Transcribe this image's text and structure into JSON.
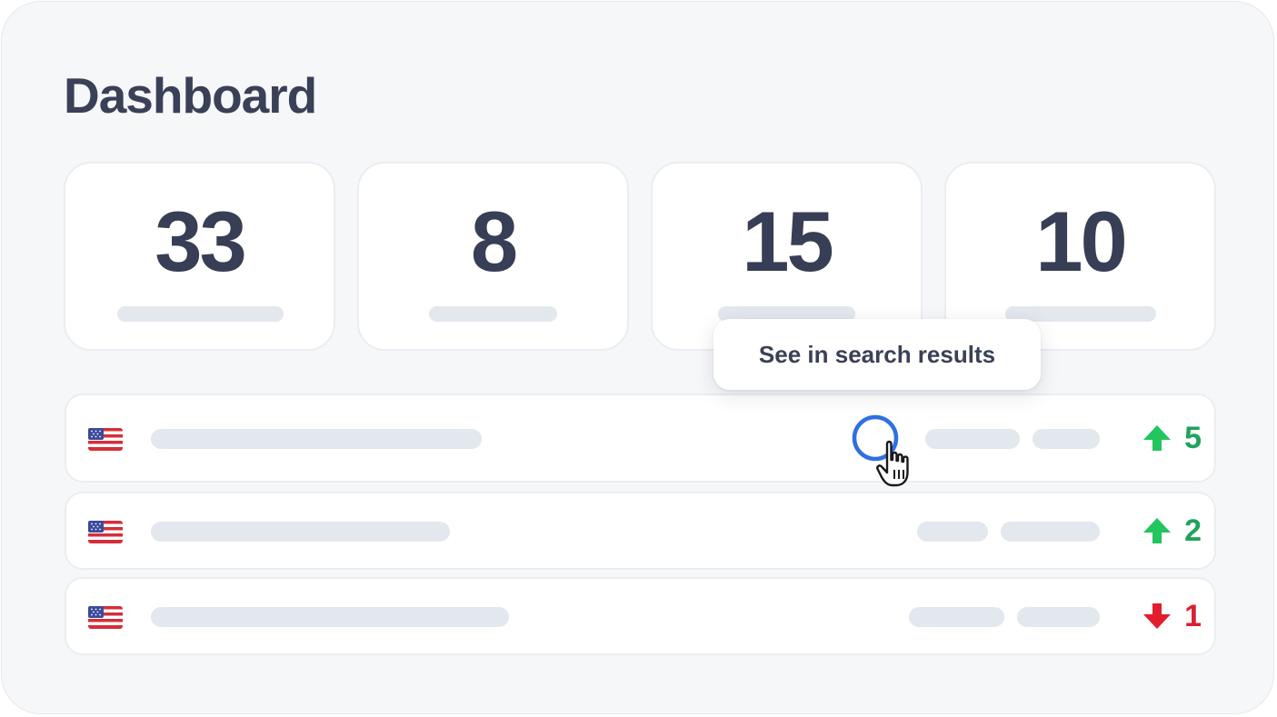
{
  "header": {
    "title": "Dashboard"
  },
  "stats": [
    {
      "value": "33"
    },
    {
      "value": "8"
    },
    {
      "value": "15"
    },
    {
      "value": "10"
    }
  ],
  "tooltip": {
    "label": "See in search results"
  },
  "rows": [
    {
      "flag": "us-flag-icon",
      "trend": "up",
      "value": "5",
      "color": "#1fa35c"
    },
    {
      "flag": "us-flag-icon",
      "trend": "up",
      "value": "2",
      "color": "#1fa35c"
    },
    {
      "flag": "us-flag-icon",
      "trend": "down",
      "value": "1",
      "color": "#d8202f"
    }
  ],
  "colors": {
    "up_arrow": "#22c55e",
    "up_text": "#1fa35c",
    "down": "#e11d2e",
    "click_ring": "#2f6fe4",
    "title": "#3a4057"
  },
  "icons": {
    "cursor": "pointer-hand-icon",
    "click": "click-ring-icon",
    "trend_up": "arrow-up-icon",
    "trend_down": "arrow-down-icon"
  }
}
